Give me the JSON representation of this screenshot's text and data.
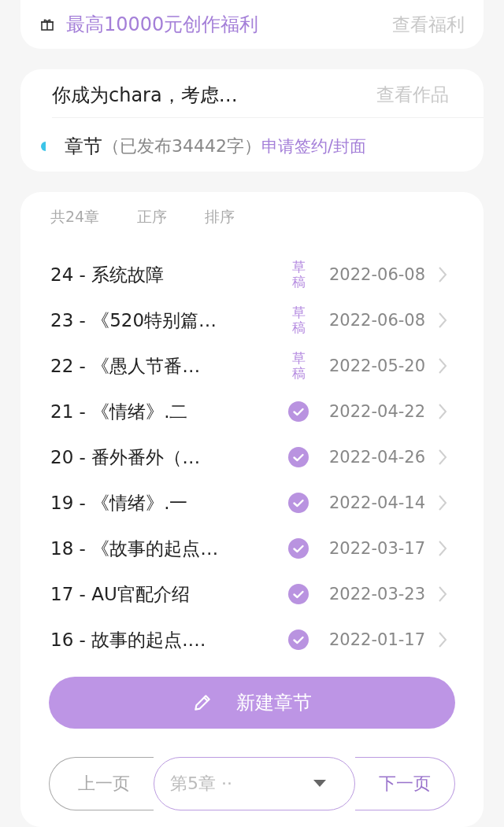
{
  "bonus": {
    "text": "最高10000元创作福利",
    "link": "查看福利"
  },
  "work": {
    "title": "你成为chara，考虑…",
    "view_link": "查看作品",
    "chapters_label": "章节",
    "published": "（已发布34442字）",
    "apply_link": "申请签约/封面"
  },
  "list_header": {
    "count": "共24章",
    "order": "正序",
    "sort": "排序"
  },
  "chapters": [
    {
      "title": "24 - 系统故障",
      "kind": "draft",
      "status": "草稿",
      "date": "2022-06-08"
    },
    {
      "title": "23 - 《520特别篇…",
      "kind": "draft",
      "status": "草稿",
      "date": "2022-06-08"
    },
    {
      "title": "22 - 《愚人节番…",
      "kind": "draft",
      "status": "草稿",
      "date": "2022-05-20"
    },
    {
      "title": "21 - 《情绪》.二",
      "kind": "published",
      "date": "2022-04-22"
    },
    {
      "title": "20 - 番外番外（…",
      "kind": "published",
      "date": "2022-04-26"
    },
    {
      "title": "19 - 《情绪》.一",
      "kind": "published",
      "date": "2022-04-14"
    },
    {
      "title": "18 - 《故事的起点…",
      "kind": "published",
      "date": "2022-03-17"
    },
    {
      "title": "17 - AU官配介绍",
      "kind": "published",
      "date": "2022-03-23"
    },
    {
      "title": "16 - 故事的起点.…",
      "kind": "published",
      "date": "2022-01-17"
    }
  ],
  "new_button": "新建章节",
  "pager": {
    "prev": {
      "label": "上一页",
      "disabled": true
    },
    "select": "第5章 ··",
    "next": {
      "label": "下一页",
      "disabled": false
    }
  }
}
